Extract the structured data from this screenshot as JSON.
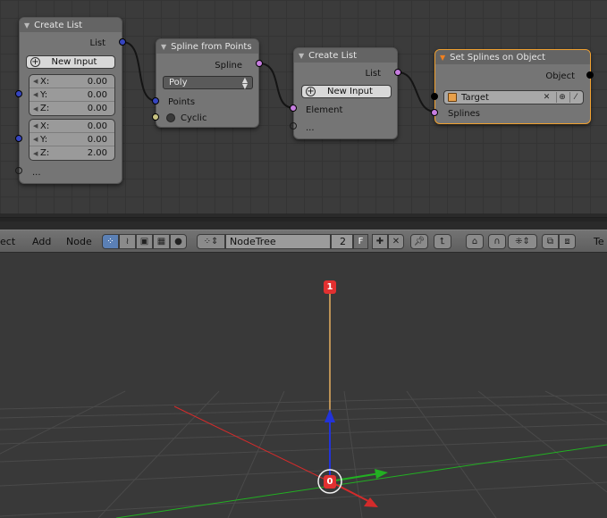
{
  "colors": {
    "editor_bg": "#3b3b3b",
    "node_body": "#757575",
    "node_header": "#646464",
    "selected_outline": "#f0a030",
    "socket_vector": "#3645c0",
    "socket_spline": "#c77de0",
    "socket_bool": "#c7c281",
    "wire": "#141414",
    "viewport_bg": "#393939",
    "axis_x": "#d42b2b",
    "axis_y": "#22b022",
    "axis_z": "#2233d9",
    "spline": "#e8b060",
    "point_marker": "#e23030"
  },
  "nodes": {
    "create_list_1": {
      "title": "Create List",
      "output_list": "List",
      "new_input": "New Input",
      "vector_a": [
        {
          "label": "X:",
          "value": "0.00"
        },
        {
          "label": "Y:",
          "value": "0.00"
        },
        {
          "label": "Z:",
          "value": "0.00"
        }
      ],
      "vector_b": [
        {
          "label": "X:",
          "value": "0.00"
        },
        {
          "label": "Y:",
          "value": "0.00"
        },
        {
          "label": "Z:",
          "value": "2.00"
        }
      ],
      "ellipsis": "..."
    },
    "spline_from_points": {
      "title": "Spline from Points",
      "output": "Spline",
      "type_value": "Poly",
      "input_points": "Points",
      "input_cyclic": "Cyclic"
    },
    "create_list_2": {
      "title": "Create List",
      "output_list": "List",
      "new_input": "New Input",
      "input_element": "Element",
      "ellipsis": "..."
    },
    "set_splines": {
      "title": "Set Splines on Object",
      "output_object": "Object",
      "target_value": "Target",
      "input_splines": "Splines"
    }
  },
  "header": {
    "menu_select_partial": "ect",
    "menu_add": "Add",
    "menu_node": "Node",
    "nodetree_name": "NodeTree",
    "user_count": "2",
    "fake_user": "F",
    "overflow_partial": "Te"
  },
  "viewport": {
    "point_labels": [
      "0",
      "1"
    ]
  }
}
